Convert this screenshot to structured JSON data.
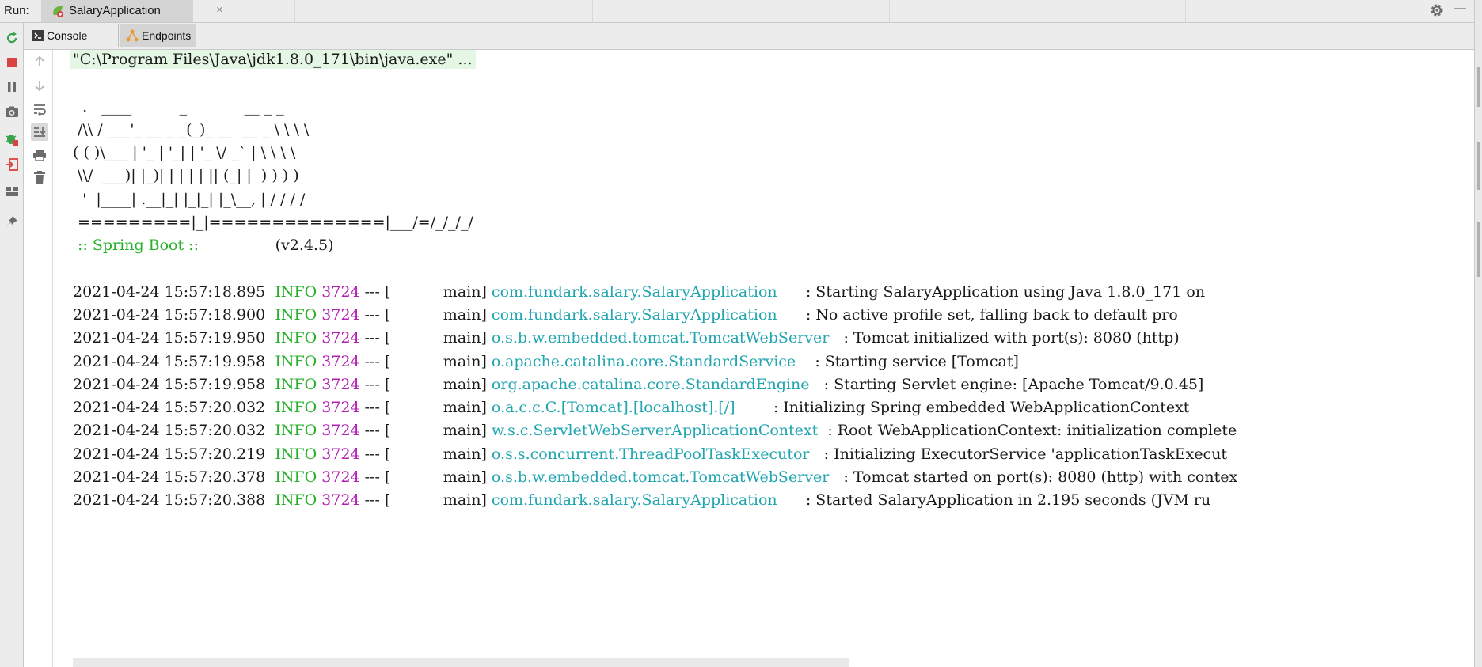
{
  "run_bar": {
    "label": "Run:",
    "tab_title": "SalaryApplication",
    "close_glyph": "×",
    "minimize_glyph": "—"
  },
  "subtabs": {
    "console": "Console",
    "endpoints": "Endpoints"
  },
  "console": {
    "command": "\"C:\\Program Files\\Java\\jdk1.8.0_171\\bin\\java.exe\" ...",
    "banner": [
      "  .   ____          _            __ _ _",
      " /\\\\ / ___'_ __ _ _(_)_ __  __ _ \\ \\ \\ \\",
      "( ( )\\___ | '_ | '_| | '_ \\/ _` | \\ \\ \\ \\",
      " \\\\/  ___)| |_)| | | | | || (_| |  ) ) ) )",
      "  '  |____| .__|_| |_|_| |_\\__, | / / / /",
      " =========|_|==============|___/=/_/_/_/"
    ],
    "spring_label": " :: Spring Boot :: ",
    "spring_version": "               (v2.4.5)",
    "log": [
      {
        "ts": "2021-04-24 15:57:18.895",
        "level": "INFO",
        "pid": "3724",
        "sep": " --- [           main] ",
        "logger": "com.fundark.salary.SalaryApplication     ",
        "msg": " : Starting SalaryApplication using Java 1.8.0_171 on"
      },
      {
        "ts": "2021-04-24 15:57:18.900",
        "level": "INFO",
        "pid": "3724",
        "sep": " --- [           main] ",
        "logger": "com.fundark.salary.SalaryApplication     ",
        "msg": " : No active profile set, falling back to default pro"
      },
      {
        "ts": "2021-04-24 15:57:19.950",
        "level": "INFO",
        "pid": "3724",
        "sep": " --- [           main] ",
        "logger": "o.s.b.w.embedded.tomcat.TomcatWebServer  ",
        "msg": " : Tomcat initialized with port(s): 8080 (http)"
      },
      {
        "ts": "2021-04-24 15:57:19.958",
        "level": "INFO",
        "pid": "3724",
        "sep": " --- [           main] ",
        "logger": "o.apache.catalina.core.StandardService   ",
        "msg": " : Starting service [Tomcat]"
      },
      {
        "ts": "2021-04-24 15:57:19.958",
        "level": "INFO",
        "pid": "3724",
        "sep": " --- [           main] ",
        "logger": "org.apache.catalina.core.StandardEngine  ",
        "msg": " : Starting Servlet engine: [Apache Tomcat/9.0.45]"
      },
      {
        "ts": "2021-04-24 15:57:20.032",
        "level": "INFO",
        "pid": "3724",
        "sep": " --- [           main] ",
        "logger": "o.a.c.c.C.[Tomcat].[localhost].[/]       ",
        "msg": " : Initializing Spring embedded WebApplicationContext"
      },
      {
        "ts": "2021-04-24 15:57:20.032",
        "level": "INFO",
        "pid": "3724",
        "sep": " --- [           main] ",
        "logger": "w.s.c.ServletWebServerApplicationContext ",
        "msg": " : Root WebApplicationContext: initialization complete"
      },
      {
        "ts": "2021-04-24 15:57:20.219",
        "level": "INFO",
        "pid": "3724",
        "sep": " --- [           main] ",
        "logger": "o.s.s.concurrent.ThreadPoolTaskExecutor  ",
        "msg": " : Initializing ExecutorService 'applicationTaskExecut"
      },
      {
        "ts": "2021-04-24 15:57:20.378",
        "level": "INFO",
        "pid": "3724",
        "sep": " --- [           main] ",
        "logger": "o.s.b.w.embedded.tomcat.TomcatWebServer  ",
        "msg": " : Tomcat started on port(s): 8080 (http) with contex"
      },
      {
        "ts": "2021-04-24 15:57:20.388",
        "level": "INFO",
        "pid": "3724",
        "sep": " --- [           main] ",
        "logger": "com.fundark.salary.SalaryApplication     ",
        "msg": " : Started SalaryApplication in 2.195 seconds (JVM ru"
      }
    ]
  },
  "icons": {
    "left_toolbar": [
      "rerun-icon",
      "stop-icon",
      "pause-icon",
      "dump-threads-icon",
      "debug-icon",
      "exit-icon",
      "layout-icon",
      "pin-icon"
    ],
    "console_toolbar": [
      "up-icon",
      "down-icon",
      "soft-wrap-icon",
      "scroll-to-end-icon",
      "print-icon",
      "clear-icon"
    ]
  },
  "colors": {
    "info": "#27b12b",
    "pid": "#b420b4",
    "logger": "#21a5b0",
    "stop": "#d94343"
  }
}
